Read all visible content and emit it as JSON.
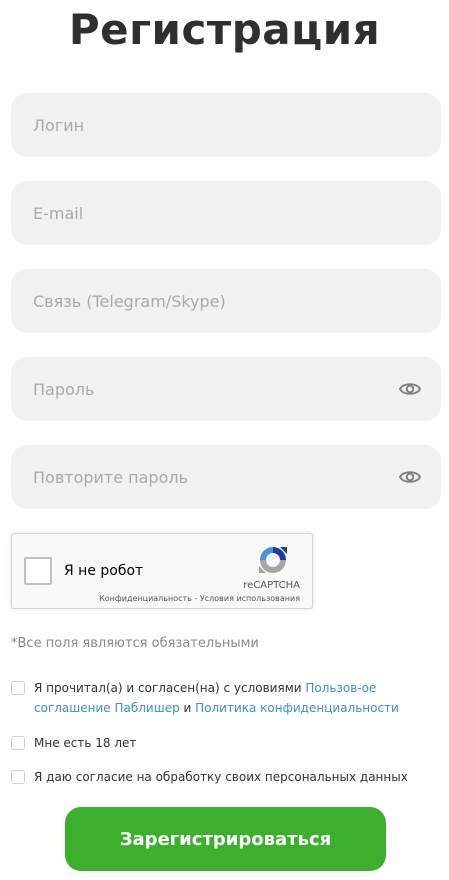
{
  "title": "Регистрация",
  "fields": {
    "login": {
      "placeholder": "Логин",
      "value": ""
    },
    "email": {
      "placeholder": "E-mail",
      "value": ""
    },
    "contact": {
      "placeholder": "Связь (Telegram/Skype)",
      "value": ""
    },
    "password": {
      "placeholder": "Пароль",
      "value": ""
    },
    "password_repeat": {
      "placeholder": "Повторите пароль",
      "value": ""
    }
  },
  "captcha": {
    "label": "Я не робот",
    "brand": "reCAPTCHA",
    "privacy": "Конфиденциальность",
    "separator": " - ",
    "terms": "Условия использования"
  },
  "required_note": "*Все поля являются обязательными",
  "agreements": {
    "terms_prefix": "Я прочитал(а) и согласен(на) с условиями ",
    "terms_link": "Пользов-ое соглашение Паблишер",
    "terms_and": " и ",
    "privacy_link": "Политика конфиденциальности",
    "age": "Мне есть 18 лет",
    "personal_data": "Я даю согласие на обработку своих персональных данных"
  },
  "submit_label": "Зарегистрироваться",
  "colors": {
    "accent": "#3cb02c",
    "link": "#3a8fd6",
    "field_bg": "#f1f1f1"
  }
}
